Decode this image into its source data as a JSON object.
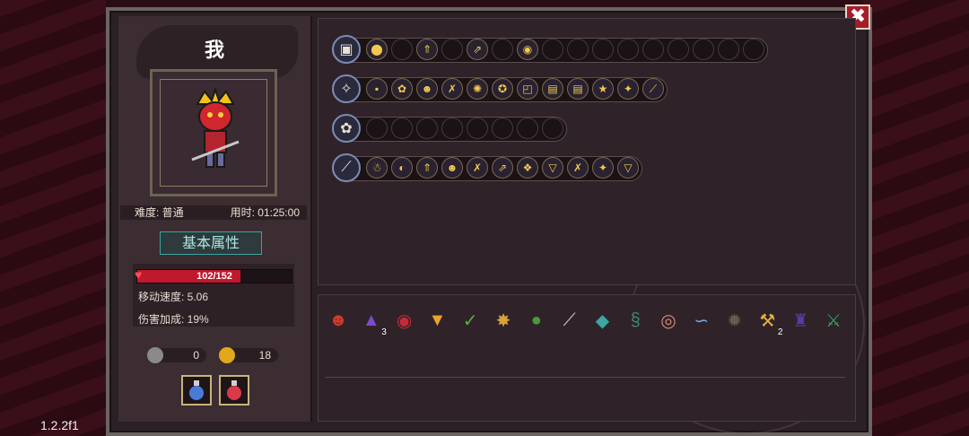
{
  "player": {
    "name": "我",
    "difficulty_label": "难度: 普通",
    "time_label": "用时: 01:25:00",
    "tab_title": "基本属性",
    "hp_text": "102/152",
    "hp_fraction": 0.67,
    "move_speed": "移动速度: 5.06",
    "damage_bonus": "伤害加成: 19%",
    "keys": "0",
    "gold": "18"
  },
  "version": "1.2.2f1",
  "close_label": "✖",
  "weapons": [
    {
      "icon": "chest-weapon-icon",
      "glyph": "▣",
      "slots": [
        "⬤",
        "",
        "⇑",
        "",
        "⇗",
        "",
        "◉",
        "",
        "",
        "",
        "",
        "",
        "",
        "",
        "",
        ""
      ]
    },
    {
      "icon": "staff-weapon-icon",
      "glyph": "✧",
      "slots": [
        "▪",
        "✿",
        "☻",
        "✗",
        "✺",
        "✪",
        "◰",
        "▤",
        "▤",
        "★",
        "✦",
        "⟋"
      ]
    },
    {
      "icon": "flower-weapon-icon",
      "glyph": "✿",
      "slots": [
        "",
        "",
        "",
        "",
        "",
        "",
        "",
        ""
      ]
    },
    {
      "icon": "sword-weapon-icon",
      "glyph": "⟋",
      "slots": [
        "☃",
        "◐",
        "⇑",
        "☻",
        "✗",
        "⇗",
        "❖",
        "▽",
        "✗",
        "✦",
        "▽"
      ]
    }
  ],
  "items": [
    {
      "name": "demon-mask-icon",
      "glyph": "☻",
      "count": "",
      "color": "#d23a2a"
    },
    {
      "name": "wizard-hat-icon",
      "glyph": "▲",
      "count": "3",
      "color": "#7a4bd1"
    },
    {
      "name": "red-eye-icon",
      "glyph": "◉",
      "count": "",
      "color": "#c62a3a"
    },
    {
      "name": "potion-glass-icon",
      "glyph": "▼",
      "count": "",
      "color": "#e8a52a"
    },
    {
      "name": "leaf-icon",
      "glyph": "✓",
      "count": "",
      "color": "#4fb33a"
    },
    {
      "name": "wing-icon",
      "glyph": "✸",
      "count": "",
      "color": "#d9a23a"
    },
    {
      "name": "frog-icon",
      "glyph": "●",
      "count": "",
      "color": "#4a9a3a"
    },
    {
      "name": "feather-icon",
      "glyph": "⟋",
      "count": "",
      "color": "#cfcfcf"
    },
    {
      "name": "gem-card-icon",
      "glyph": "◆",
      "count": "",
      "color": "#3aa7a0"
    },
    {
      "name": "scroll-icon",
      "glyph": "§",
      "count": "",
      "color": "#3a8a6a"
    },
    {
      "name": "egg-icon",
      "glyph": "◎",
      "count": "",
      "color": "#d48a7a"
    },
    {
      "name": "snake-icon",
      "glyph": "∽",
      "count": "",
      "color": "#7aa6e0"
    },
    {
      "name": "spider-icon",
      "glyph": "✹",
      "count": "",
      "color": "#6a5a4a"
    },
    {
      "name": "pickaxe-icon",
      "glyph": "⚒",
      "count": "2",
      "color": "#e0b040"
    },
    {
      "name": "cloak-icon",
      "glyph": "♜",
      "count": "",
      "color": "#5a3aa8"
    },
    {
      "name": "sword-item-icon",
      "glyph": "⚔",
      "count": "",
      "color": "#3aa060"
    }
  ]
}
